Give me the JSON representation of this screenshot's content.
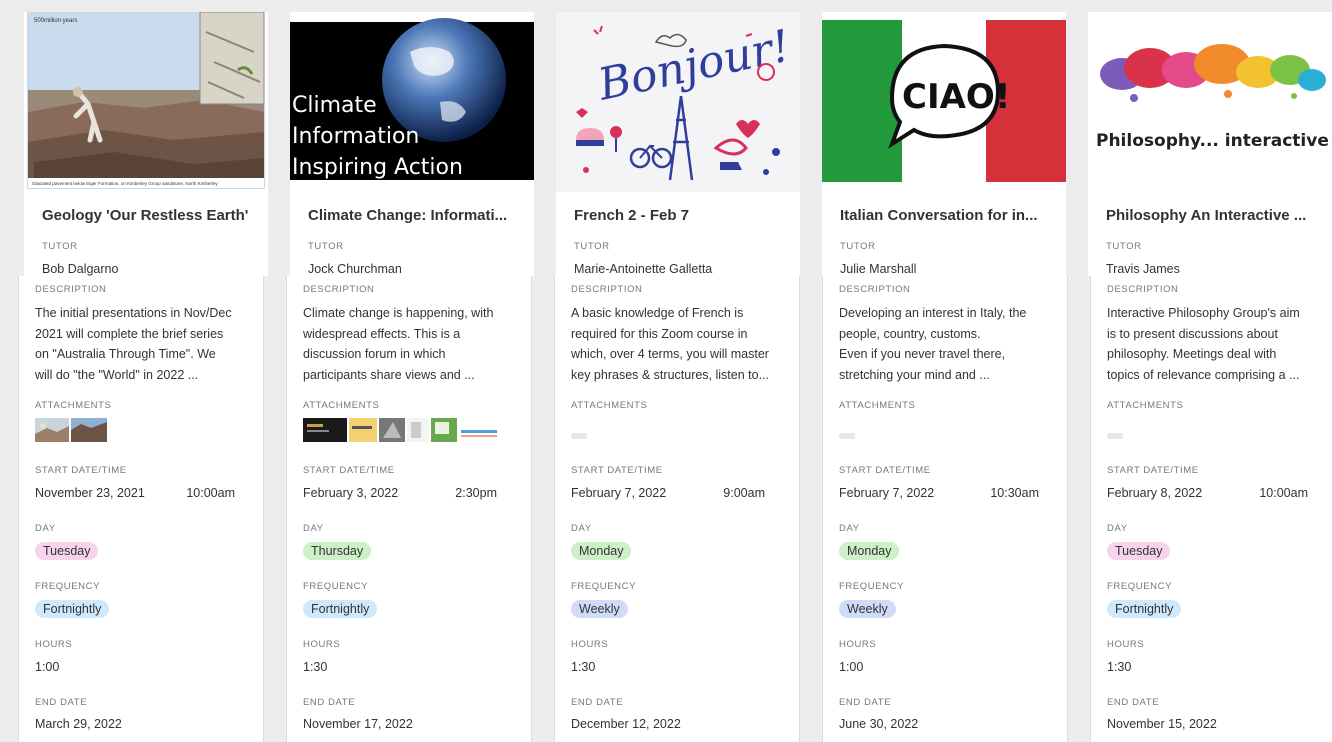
{
  "labels": {
    "tutor": "TUTOR",
    "description": "DESCRIPTION",
    "attachments": "ATTACHMENTS",
    "start": "START DATE/TIME",
    "day": "DAY",
    "frequency": "FREQUENCY",
    "hours": "HOURS",
    "end": "END DATE"
  },
  "colors": {
    "tuesday": "#f9d3ee",
    "thursday": "#cdf0c9",
    "monday": "#cdf0c9",
    "fortnightly": "#cfe8fb",
    "weekly": "#d0dbfa"
  },
  "cards": [
    {
      "title": "Geology 'Our Restless Earth'",
      "tutor": "Bob Dalgarno",
      "image_caption_small": "500million years",
      "image_footer": "Glaciated pavement below Eiger Formation, on Kimberley Group sandstone, North Kimberley",
      "description": "The initial presentations in Nov/Dec\n2021 will complete the brief series\non \"Australia Through Time\". We\nwill do \"the \"World\" in 2022 ...",
      "start_date": "November 23, 2021",
      "start_time": "10:00am",
      "day": "Tuesday",
      "frequency": "Fortnightly",
      "hours": "1:00",
      "end_date": "March 29, 2022"
    },
    {
      "title": "Climate Change: Informati...",
      "tutor": "Jock Churchman",
      "image_text_1": "Climate",
      "image_text_2": "Information",
      "image_text_3": "Inspiring Action",
      "description": "Climate change is happening, with\nwidespread effects. This is a\ndiscussion forum in which\nparticipants share views and ...",
      "start_date": "February 3, 2022",
      "start_time": "2:30pm",
      "day": "Thursday",
      "frequency": "Fortnightly",
      "hours": "1:30",
      "end_date": "November 17, 2022"
    },
    {
      "title": "French 2 - Feb 7",
      "tutor": "Marie-Antoinette Galletta",
      "image_text": "Bonjour!",
      "description": "A basic knowledge of French is\nrequired for this Zoom course in\nwhich, over 4 terms, you will master\nkey phrases & structures, listen to...",
      "start_date": "February 7, 2022",
      "start_time": "9:00am",
      "day": "Monday",
      "frequency": "Weekly",
      "hours": "1:30",
      "end_date": "December 12, 2022"
    },
    {
      "title": "Italian Conversation for in...",
      "tutor": "Julie Marshall",
      "image_text": "CIAO!",
      "description": "Developing an interest in Italy, the\npeople, country, customs.\nEven if you never travel there,\nstretching your mind and ...",
      "start_date": "February 7, 2022",
      "start_time": "10:30am",
      "day": "Monday",
      "frequency": "Weekly",
      "hours": "1:00",
      "end_date": "June 30, 2022"
    },
    {
      "title": "Philosophy An Interactive ...",
      "tutor": "Travis James",
      "image_text": "Philosophy... interactive",
      "description": "Interactive Philosophy Group's aim\nis to present discussions about\nphilosophy. Meetings deal with\ntopics of relevance comprising a ...",
      "start_date": "February 8, 2022",
      "start_time": "10:00am",
      "day": "Tuesday",
      "frequency": "Fortnightly",
      "hours": "1:30",
      "end_date": "November 15, 2022"
    }
  ]
}
